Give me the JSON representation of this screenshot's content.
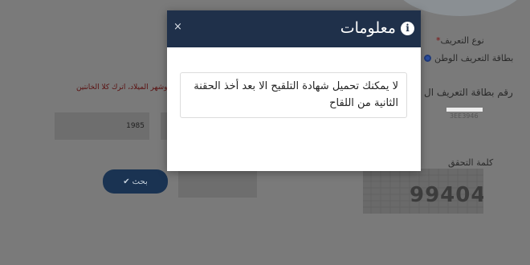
{
  "background": {
    "identification_type_label": "نوع التعريف",
    "required_mark": "*",
    "national_id_option": "بطاقة التعريف الوطن",
    "id_number_label": "رقم بطاقة التعريف ال",
    "id_number_value_partial": "3EE3946",
    "birth_hint": "ى يوم وشهر الميلاد، اترك كلا الخانتين",
    "birth_year_value": "1985",
    "search_button_label": "بحث",
    "captcha_label": "كلمة التحقق",
    "captcha_code": "99404"
  },
  "modal": {
    "title": "معلومات",
    "close_label": "×",
    "message": "لا يمكنك تحميل شهادة التلقيح الا بعد أخذ الحقنة الثانية من اللقاح"
  },
  "colors": {
    "header_bg": "#1f304a",
    "overlay_bg": "#7a7a7a",
    "search_button_bg": "#1a3352"
  }
}
